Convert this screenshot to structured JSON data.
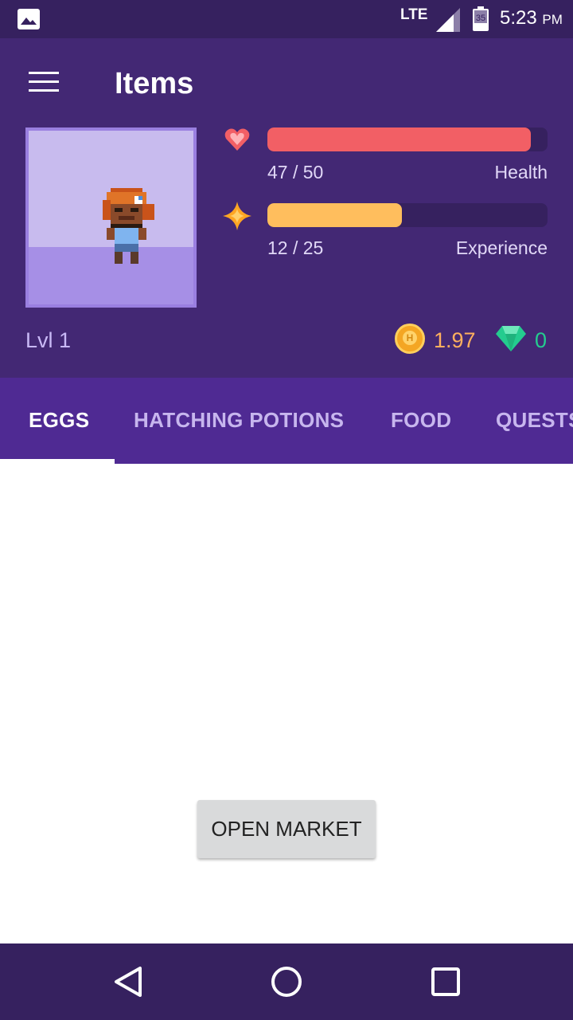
{
  "status_bar": {
    "network": "LTE",
    "battery_level": "35",
    "time": "5:23",
    "ampm": "PM",
    "icons": [
      "image-notification-icon",
      "signal-icon",
      "battery-icon"
    ]
  },
  "header": {
    "title": "Items",
    "menu_icon": "hamburger-menu-icon"
  },
  "stats": {
    "health": {
      "value_text": "47 / 50",
      "label": "Health",
      "fraction": 0.94,
      "color": "#f25f65",
      "icon": "heart-icon"
    },
    "experience": {
      "value_text": "12 / 25",
      "label": "Experience",
      "fraction": 0.48,
      "color": "#ffbe5d",
      "icon": "star-icon"
    }
  },
  "level": "Lvl 1",
  "currency": {
    "gold": "1.97",
    "gold_icon": "gold-coin-icon",
    "gems": "0",
    "gems_icon": "gem-icon"
  },
  "tabs": [
    {
      "label": "EGGS",
      "active": true
    },
    {
      "label": "HATCHING POTIONS",
      "active": false
    },
    {
      "label": "FOOD",
      "active": false
    },
    {
      "label": "QUESTS",
      "active": false
    }
  ],
  "main": {
    "open_market_label": "OPEN MARKET"
  },
  "nav_bar": {
    "icons": [
      "back-icon",
      "home-icon",
      "recents-icon"
    ]
  },
  "colors": {
    "status_bar": "#36215f",
    "header": "#432874",
    "tab_bar": "#4f2a93",
    "accent_gold": "#ffb05e",
    "accent_gem": "#24cc8f"
  }
}
